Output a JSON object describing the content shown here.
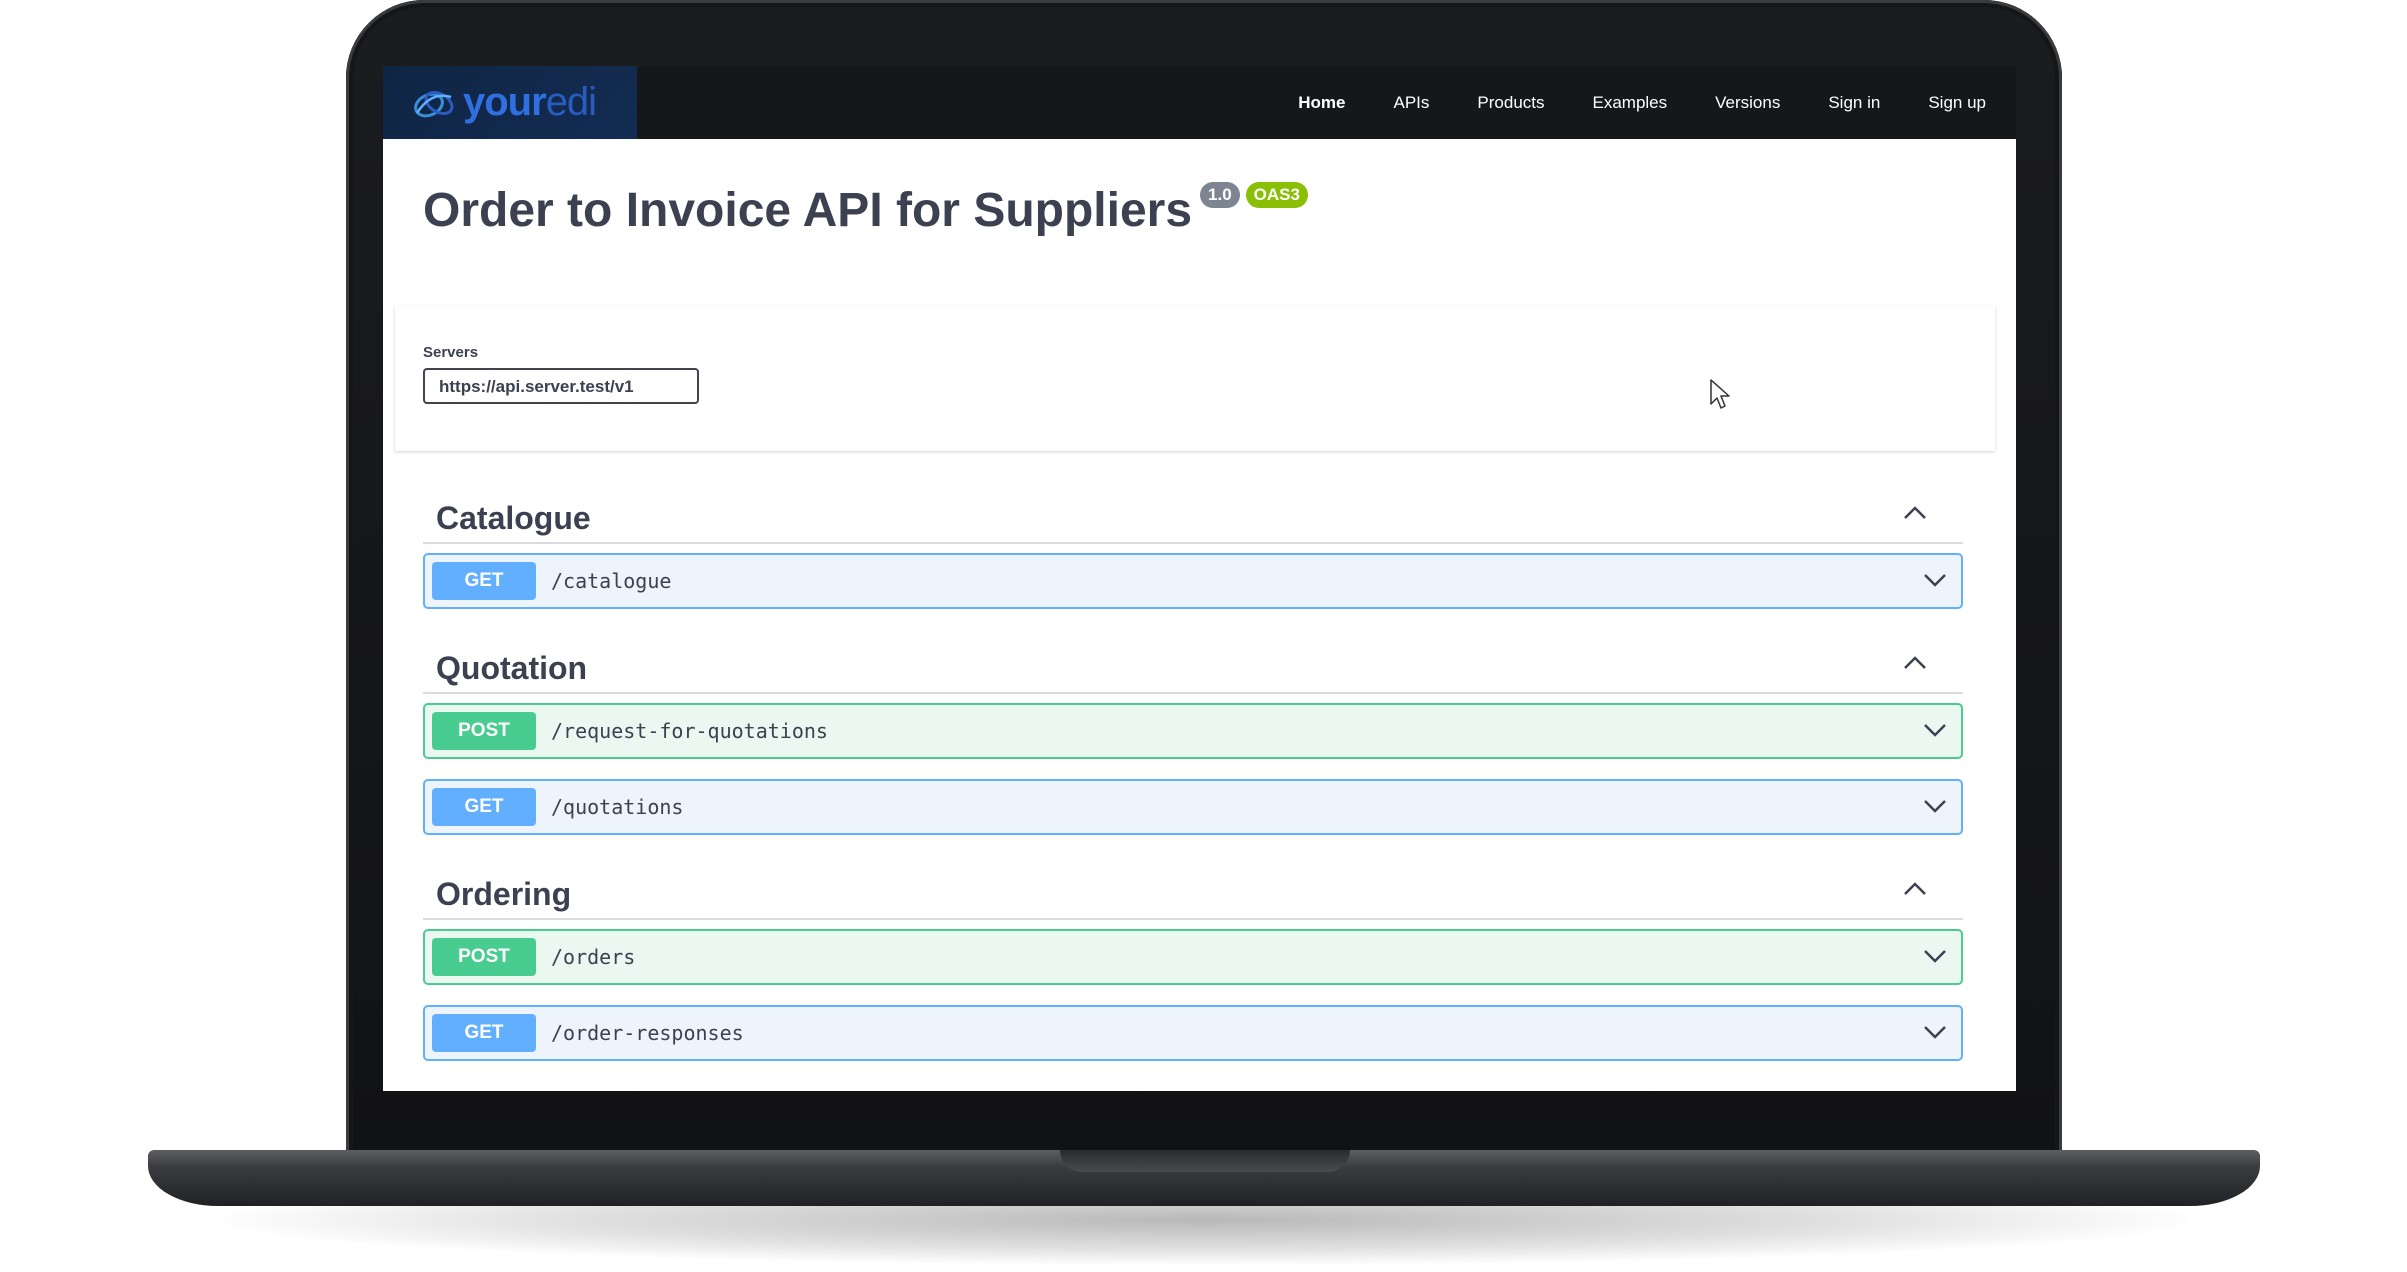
{
  "brand": {
    "logo_main": "your",
    "logo_accent": "edi"
  },
  "nav": {
    "items": [
      "Home",
      "APIs",
      "Products",
      "Examples",
      "Versions",
      "Sign in",
      "Sign up"
    ],
    "active": "Home"
  },
  "header": {
    "title": "Order to Invoice API for Suppliers",
    "version_badge": "1.0",
    "spec_badge": "OAS3"
  },
  "servers": {
    "label": "Servers",
    "selected": "https://api.server.test/v1"
  },
  "sections": [
    {
      "title": "Catalogue",
      "operations": [
        {
          "method": "GET",
          "path": "/catalogue"
        }
      ]
    },
    {
      "title": "Quotation",
      "operations": [
        {
          "method": "POST",
          "path": "/request-for-quotations"
        },
        {
          "method": "GET",
          "path": "/quotations"
        }
      ]
    },
    {
      "title": "Ordering",
      "operations": [
        {
          "method": "POST",
          "path": "/orders"
        },
        {
          "method": "GET",
          "path": "/order-responses"
        }
      ]
    }
  ],
  "colors": {
    "get": "#61affe",
    "post": "#49cc90",
    "topbar": "#15171a",
    "text": "#3b4151"
  },
  "icons": {
    "collapse": "chevron-up-icon",
    "expand": "chevron-down-icon",
    "cursor": "mouse-pointer-icon"
  }
}
